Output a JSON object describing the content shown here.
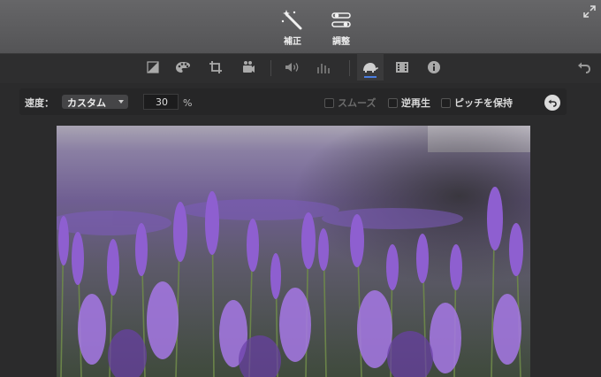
{
  "top": {
    "enhance_label": "補正",
    "adjust_label": "調整"
  },
  "toolbar": {
    "tools": [
      "color-balance-icon",
      "palette-icon",
      "crop-icon",
      "camera-icon",
      "volume-icon",
      "equalizer-icon",
      "speed-icon",
      "film-icon",
      "info-icon"
    ],
    "active_tool": "speed-icon"
  },
  "speed_panel": {
    "speed_label": "速度：",
    "speed_option": "カスタム",
    "percent_value": "30",
    "percent_unit": "%",
    "smooth_label": "スムーズ",
    "reverse_label": "逆再生",
    "preserve_pitch_label": "ピッチを保持"
  },
  "colors": {
    "accent": "#4a7de0",
    "lavender": "#7b55b5"
  }
}
